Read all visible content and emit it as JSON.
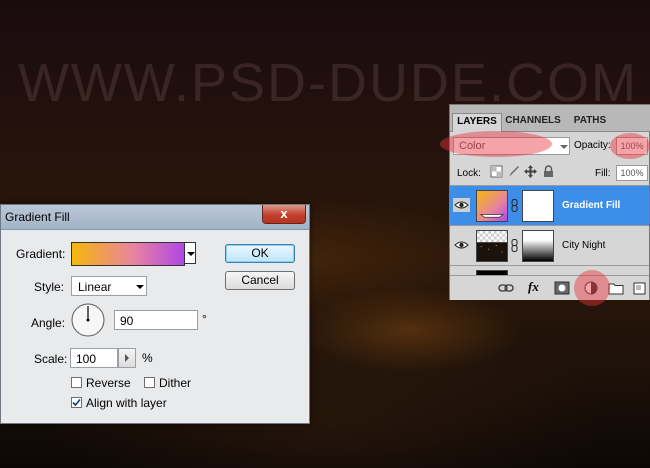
{
  "watermark": "WWW.PSD-DUDE.COM",
  "dialog": {
    "title": "Gradient Fill",
    "close_glyph": "x",
    "gradient_label": "Gradient:",
    "gradient_colors": [
      "#f5b80a",
      "#e883a0",
      "#b047e8"
    ],
    "style_label": "Style:",
    "style_value": "Linear",
    "angle_label": "Angle:",
    "angle_value": "90",
    "degree_symbol": "°",
    "scale_label": "Scale:",
    "scale_value": "100",
    "percent_symbol": "%",
    "reverse_label": "Reverse",
    "reverse_checked": false,
    "dither_label": "Dither",
    "dither_checked": false,
    "align_label": "Align with layer",
    "align_checked": true,
    "ok_label": "OK",
    "cancel_label": "Cancel"
  },
  "layers_panel": {
    "tabs": [
      "LAYERS",
      "CHANNELS",
      "PATHS"
    ],
    "active_tab": "LAYERS",
    "blend_mode": "Color",
    "opacity_label": "Opacity:",
    "opacity_value": "100%",
    "lock_label": "Lock:",
    "fill_label": "Fill:",
    "fill_value": "100%",
    "layers": [
      {
        "name": "Gradient Fill",
        "selected": true,
        "visible": true
      },
      {
        "name": "City Night",
        "selected": false,
        "visible": true
      },
      {
        "name": "",
        "selected": false,
        "visible": true
      }
    ],
    "fx_label": "fx",
    "selected_color": "#3d8ee8"
  }
}
